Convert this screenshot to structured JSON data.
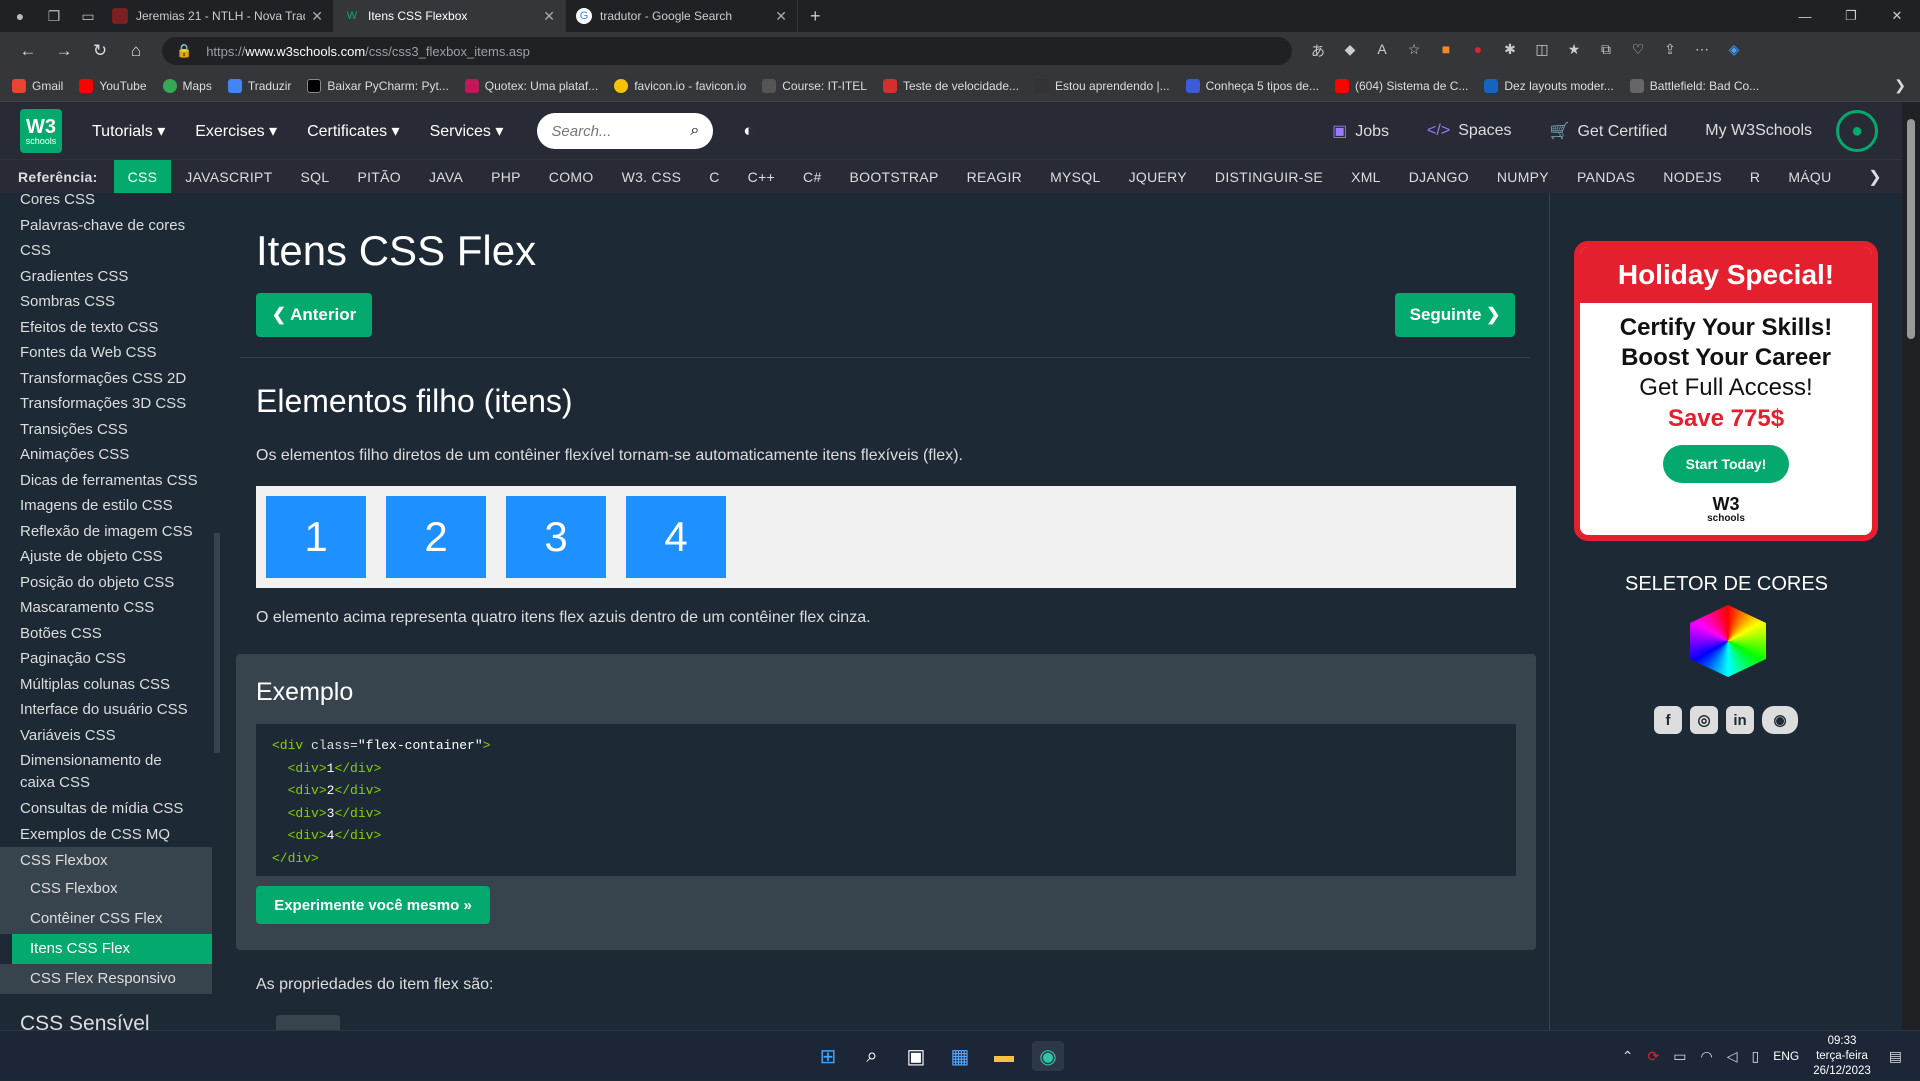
{
  "browser": {
    "tabs": [
      {
        "title": "Jeremias 21 - NTLH - Nova Tradu",
        "active": false
      },
      {
        "title": "Itens CSS Flexbox",
        "active": true
      },
      {
        "title": "tradutor - Google Search",
        "active": false
      }
    ],
    "url_prefix": "https://",
    "url_host": "www.w3schools.com",
    "url_path": "/css/css3_flexbox_items.asp",
    "bookmarks": [
      "Gmail",
      "YouTube",
      "Maps",
      "Traduzir",
      "Baixar PyCharm: Pyt...",
      "Quotex: Uma plataf...",
      "favicon.io - favicon.io",
      "Course: IT-ITEL",
      "Teste de velocidade...",
      "Estou aprendendo |...",
      "Conheça 5 tipos de...",
      "(604) Sistema de C...",
      "Dez layouts moder...",
      "Battlefield: Bad Co..."
    ]
  },
  "site": {
    "logo_main": "W3",
    "logo_sub": "schools",
    "menu": [
      "Tutorials ▾",
      "Exercises ▾",
      "Certificates ▾",
      "Services ▾"
    ],
    "search_placeholder": "Search...",
    "right_menu": [
      "Jobs",
      "Spaces",
      "Get Certified",
      "My W3Schools"
    ],
    "ref_label": "Referência:",
    "ref_items": [
      "CSS",
      "JAVASCRIPT",
      "SQL",
      "PITÃO",
      "JAVA",
      "PHP",
      "COMO",
      "W3. CSS",
      "C",
      "C++",
      "C#",
      "BOOTSTRAP",
      "REAGIR",
      "MYSQL",
      "JQUERY",
      "DISTINGUIR-SE",
      "XML",
      "DJANGO",
      "NUMPY",
      "PANDAS",
      "NODEJS",
      "R",
      "MÁQU"
    ]
  },
  "sidebar": {
    "items": [
      "Cores CSS",
      "Palavras-chave de cores CSS",
      "Gradientes CSS",
      "Sombras CSS",
      "Efeitos de texto CSS",
      "Fontes da Web CSS",
      "Transformações CSS 2D",
      "Transformações 3D CSS",
      "Transições CSS",
      "Animações CSS",
      "Dicas de ferramentas CSS",
      "Imagens de estilo CSS",
      "Reflexão de imagem CSS",
      "Ajuste de objeto CSS",
      "Posição do objeto CSS",
      "Mascaramento CSS",
      "Botões CSS",
      "Paginação CSS",
      "Múltiplas colunas CSS",
      "Interface do usuário CSS",
      "Variáveis CSS",
      "Dimensionamento de caixa CSS",
      "Consultas de mídia CSS",
      "Exemplos de CSS MQ"
    ],
    "group": "CSS Flexbox",
    "subitems": [
      "CSS Flexbox",
      "Contêiner CSS Flex",
      "Itens CSS Flex",
      "CSS Flex Responsivo"
    ],
    "section_heading": "CSS Sensível"
  },
  "main": {
    "title": "Itens CSS Flex",
    "prev": "❮ Anterior",
    "next": "Seguinte ❯",
    "h2": "Elementos filho (itens)",
    "p1": "Os elementos filho diretos de um contêiner flexível tornam-se automaticamente itens flexíveis (flex).",
    "flex_items": [
      "1",
      "2",
      "3",
      "4"
    ],
    "p2": "O elemento acima representa quatro itens flex azuis dentro de um contêiner flex cinza.",
    "example_title": "Exemplo",
    "try_btn": "Experimente você mesmo »",
    "p3": "As propriedades do item flex são:"
  },
  "ad": {
    "header": "Holiday Special!",
    "line1": "Certify Your Skills!",
    "line2": "Boost Your Career",
    "line3": "Get Full Access!",
    "line4": "Save 775$",
    "cta": "Start Today!",
    "logo_main": "W3",
    "logo_sub": "schools"
  },
  "color_picker_title": "SELETOR DE CORES",
  "social": [
    "f",
    "◎",
    "in",
    "◉"
  ],
  "taskbar": {
    "lang": "ENG",
    "time": "09:33",
    "day": "terça-feira",
    "date": "26/12/2023"
  },
  "colors": {
    "accent": "#04aa6d",
    "flex_item": "#1e90ff",
    "ad_red": "#e4202e"
  }
}
